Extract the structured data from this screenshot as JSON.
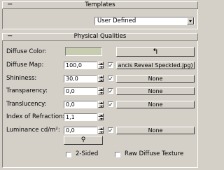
{
  "templates_rollout": {
    "sign": "−",
    "title": "Templates",
    "dropdown_value": "User Defined"
  },
  "physical_rollout": {
    "sign": "−",
    "title": "Physical Qualities",
    "rows": [
      {
        "label": "Diffuse Color:"
      },
      {
        "label": "Diffuse Map:",
        "value": "100,0",
        "checked": true,
        "map": "ancis Reveal Speckled.jpg)"
      },
      {
        "label": "Shininess:",
        "value": "30,0",
        "checked": true,
        "map": "None"
      },
      {
        "label": "Transparency:",
        "value": "0,0",
        "checked": true,
        "map": "None"
      },
      {
        "label": "Translucency:",
        "value": "0,0",
        "checked": true,
        "map": "None"
      },
      {
        "label": "Index of Refraction:",
        "value": "1,1"
      },
      {
        "label": "Luminance cd/m²:",
        "value": "0,0",
        "checked": true,
        "map": "None"
      }
    ],
    "diffuse_color_button_icon": "↰",
    "eyedropper_icon": "⚲",
    "two_sided_label": "2-Sided",
    "raw_diffuse_label": "Raw Diffuse Texture",
    "colors": {
      "diffuse_swatch": "#c8ccb0"
    }
  }
}
